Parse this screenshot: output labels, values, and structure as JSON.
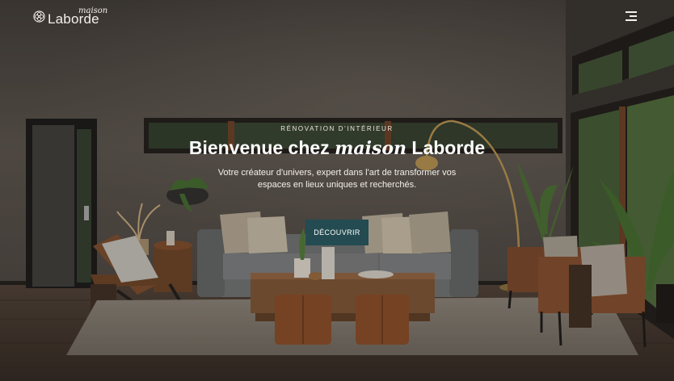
{
  "header": {
    "brand_small": "maison",
    "brand_big": "Laborde",
    "logo_icon": "flower-emblem-icon",
    "menu_icon": "hamburger-menu-icon"
  },
  "hero": {
    "eyebrow": "RÉNOVATION D'INTÉRIEUR",
    "headline_before": "Bienvenue chez ",
    "headline_accent": "maison",
    "headline_after": " Laborde",
    "subtitle_line1": "Votre créateur d'univers, expert dans l'art de transformer vos",
    "subtitle_line2": "espaces en lieux uniques et recherchés.",
    "cta_label": "DÉCOUVRIR"
  },
  "colors": {
    "cta_background": "#244b52",
    "text_light": "#ffffff",
    "overlay": "#3a3530"
  }
}
